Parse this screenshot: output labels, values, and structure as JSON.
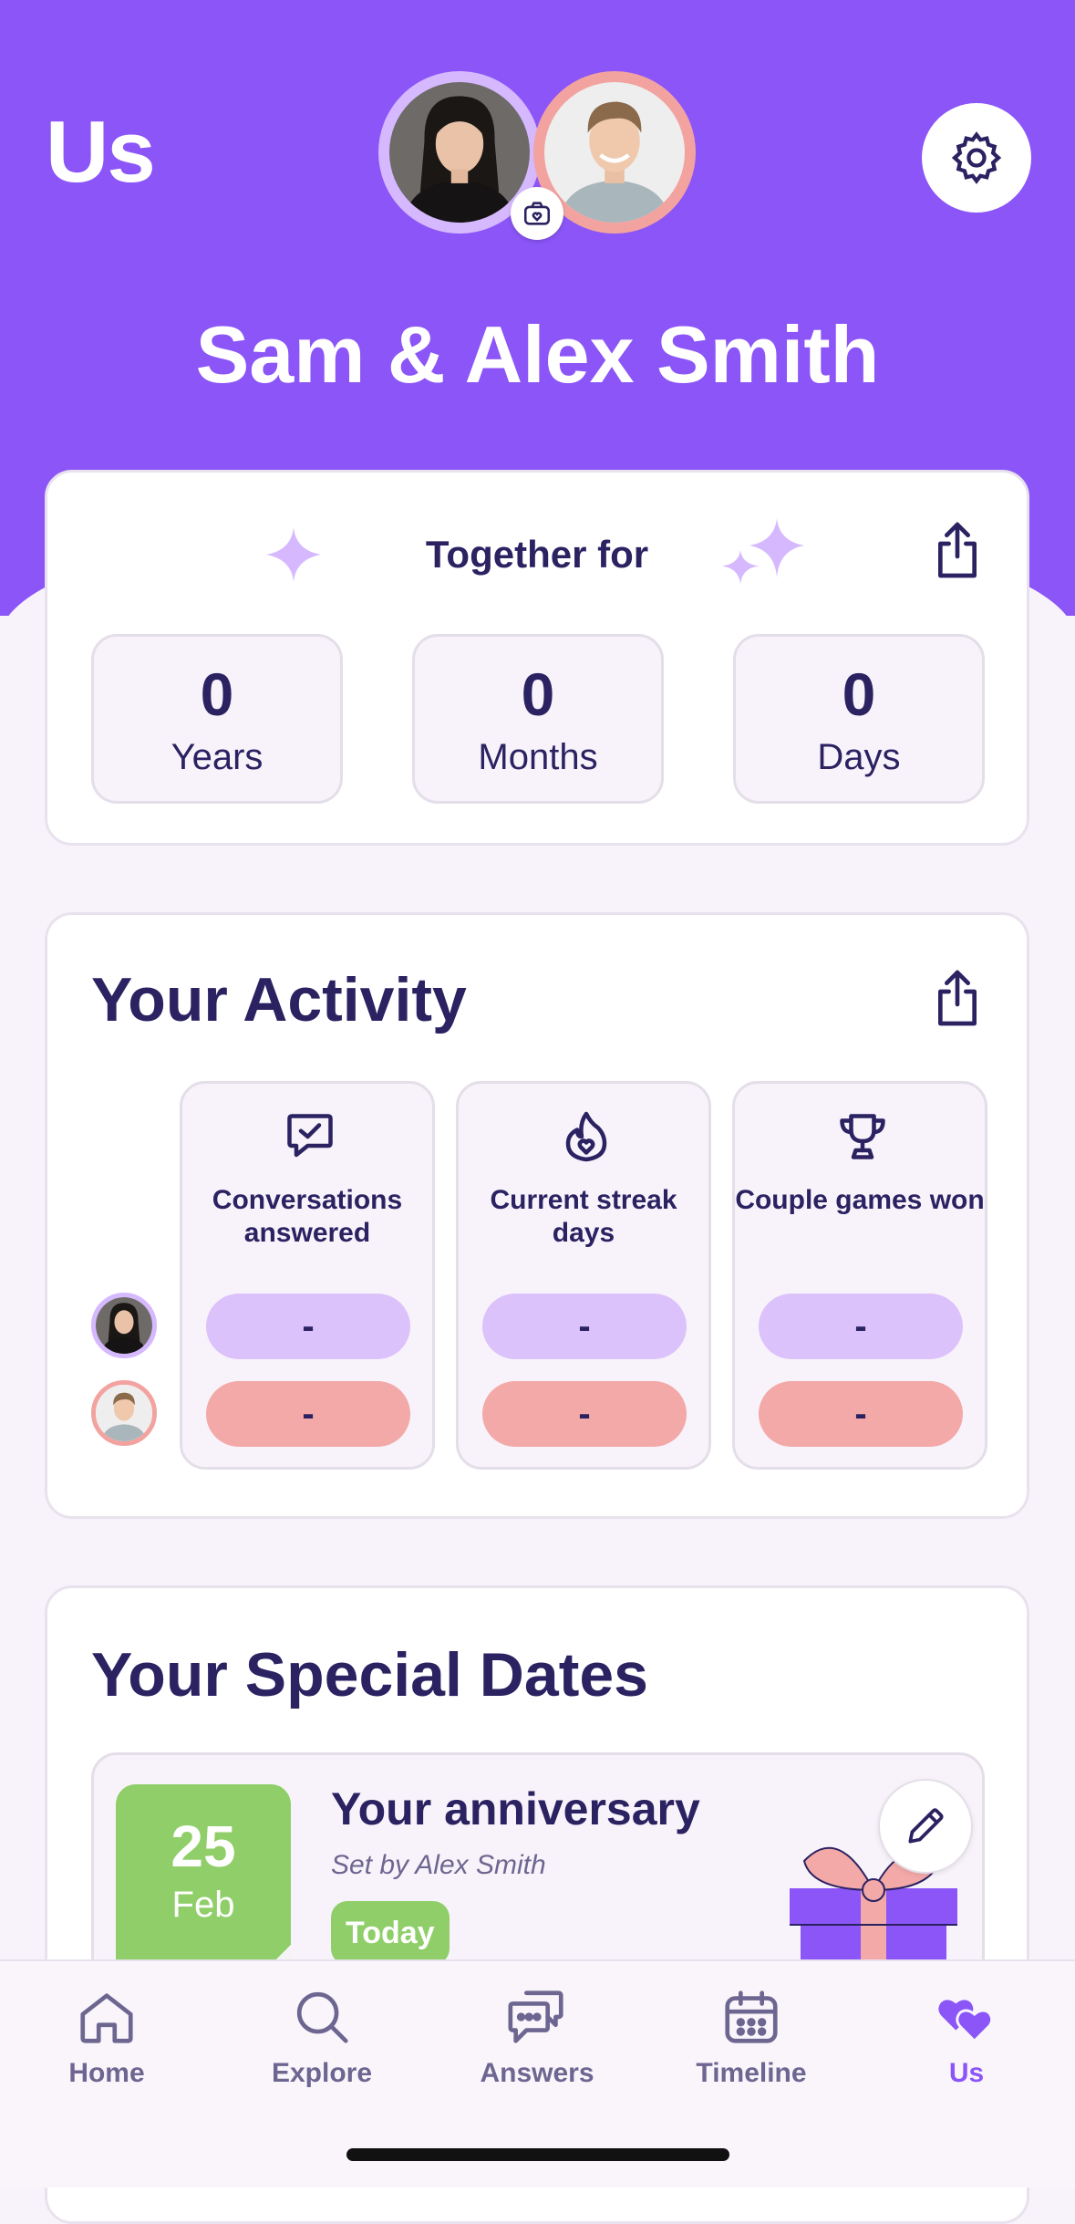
{
  "header": {
    "title": "Us",
    "couple_name": "Sam & Alex Smith",
    "accent_color": "#8b55f7"
  },
  "together": {
    "title": "Together for",
    "stats": [
      {
        "value": "0",
        "label": "Years"
      },
      {
        "value": "0",
        "label": "Months"
      },
      {
        "value": "0",
        "label": "Days"
      }
    ]
  },
  "activity": {
    "title": "Your Activity",
    "columns": [
      {
        "label": "Conversations answered",
        "icon": "chat-check-icon",
        "partner1": "-",
        "partner2": "-"
      },
      {
        "label": "Current streak days",
        "icon": "flame-heart-icon",
        "partner1": "-",
        "partner2": "-"
      },
      {
        "label": "Couple games won",
        "icon": "trophy-icon",
        "partner1": "-",
        "partner2": "-"
      }
    ]
  },
  "special_dates": {
    "title": "Your Special Dates",
    "items": [
      {
        "day": "25",
        "month": "Feb",
        "title": "Your anniversary",
        "subtitle": "Set by Alex Smith",
        "badge": "Today"
      }
    ]
  },
  "tabs": [
    {
      "label": "Home",
      "icon": "home-icon"
    },
    {
      "label": "Explore",
      "icon": "search-icon"
    },
    {
      "label": "Answers",
      "icon": "chat-bubbles-icon"
    },
    {
      "label": "Timeline",
      "icon": "calendar-icon"
    },
    {
      "label": "Us",
      "icon": "hearts-icon",
      "active": true
    }
  ]
}
